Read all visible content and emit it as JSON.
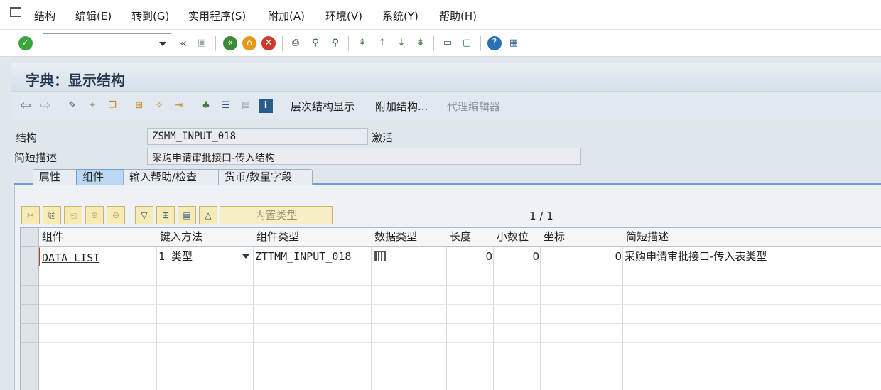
{
  "menu": [
    "结构",
    "编辑(E)",
    "转到(G)",
    "实用程序(S)",
    "附加(A)",
    "环境(V)",
    "系统(Y)",
    "帮助(H)"
  ],
  "command_field": {
    "value": ""
  },
  "nav_prev": "«",
  "title": "字典：显示结构",
  "app_toolbar": {
    "hierarchy_label": "层次结构显示",
    "append_label": "附加结构...",
    "proxy_label": "代理编辑器"
  },
  "header": {
    "structure_label": "结构",
    "structure_value": "ZSMM_INPUT_018",
    "status": "激活",
    "desc_label": "简短描述",
    "desc_value": "采购申请审批接口-传入结构"
  },
  "tabs": [
    {
      "label": "属性",
      "active": false
    },
    {
      "label": "组件",
      "active": true
    },
    {
      "label": "输入帮助/检查",
      "active": false
    },
    {
      "label": "货币/数量字段",
      "active": false
    }
  ],
  "grid_toolbar": {
    "builtin_type_label": "内置类型",
    "pager": "1 / 1"
  },
  "table": {
    "headers": [
      "组件",
      "键入方法",
      "组件类型",
      "数据类型",
      "长度",
      "小数位",
      "坐标",
      "简短描述"
    ],
    "rows": [
      {
        "component": "DATA_LIST",
        "typing_method": "1 类型",
        "component_type": "ZTTMM_INPUT_018",
        "data_type_icon": "table-type-icon",
        "length": "0",
        "decimals": "0",
        "coordinate": "0",
        "description": "采购申请审批接口-传入表类型"
      }
    ]
  },
  "colors": {
    "tab_active": "#bcd7f3",
    "title_text": "#24384e",
    "grid_button": "#f6eab5"
  }
}
